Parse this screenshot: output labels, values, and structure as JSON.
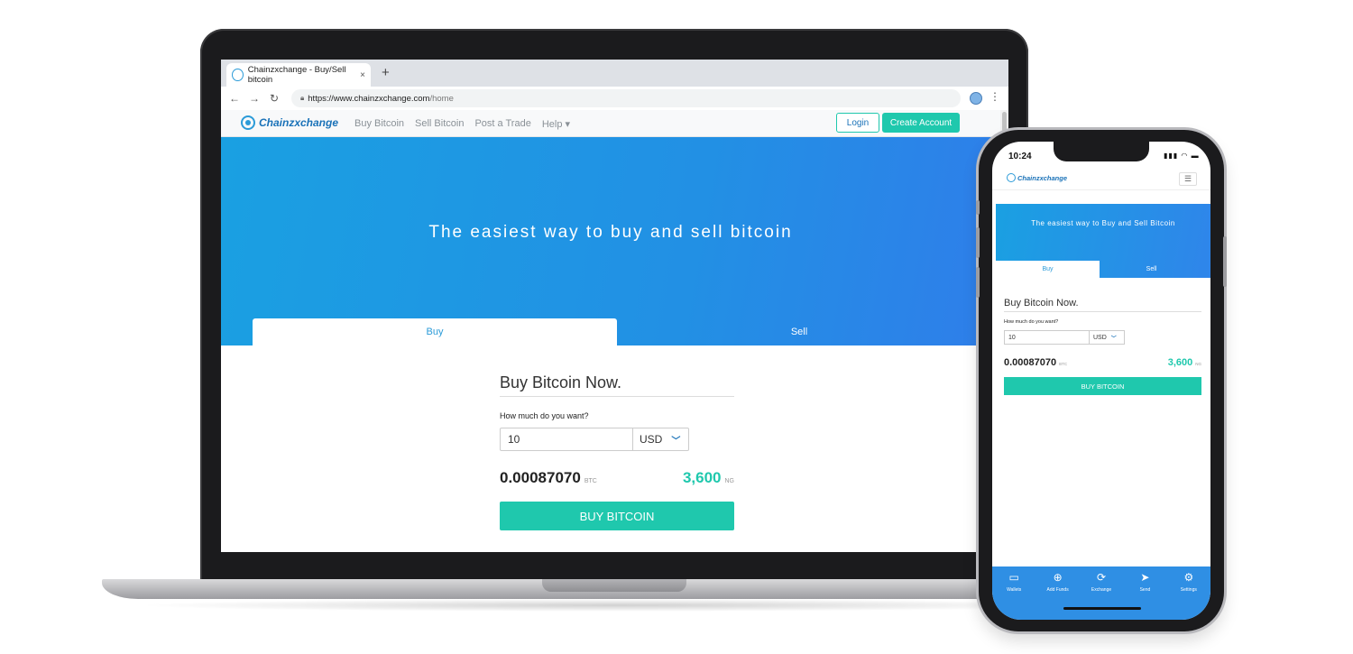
{
  "browser": {
    "tab_title": "Chainzxchange - Buy/Sell bitcoin",
    "tab_close": "×",
    "new_tab": "+",
    "url_host": "https://www.chainzxchange.com",
    "url_path": "/home",
    "back": "←",
    "forward": "→",
    "reload": "↻",
    "menu": "⋮"
  },
  "site": {
    "logo_text": "Chainzxchange",
    "nav": [
      "Buy Bitcoin",
      "Sell Bitcoin",
      "Post a Trade",
      "Help ▾"
    ],
    "login": "Login",
    "create_account": "Create Account",
    "hero_title": "The easiest way to buy and sell bitcoin",
    "tab_buy": "Buy",
    "tab_sell": "Sell",
    "form": {
      "heading": "Buy Bitcoin Now.",
      "amount_label": "How much do you want?",
      "amount_value": "10",
      "currency": "USD",
      "btc_amount": "0.00087070",
      "btc_unit": "BTC",
      "ngn_amount": "3,600",
      "ngn_unit": "NG",
      "buy_button": "BUY BITCOIN"
    }
  },
  "phone": {
    "time": "10:24",
    "status_icons": "▮▮▮ ◠ ▬",
    "logo_text": "Chainzxchange",
    "menu_icon": "☰",
    "hero_title": "The easiest way  to Buy and Sell Bitcoin",
    "tab_buy": "Buy",
    "tab_sell": "Sell",
    "form": {
      "heading": "Buy Bitcoin Now.",
      "amount_label": "How much do you want?",
      "amount_value": "10",
      "currency": "USD",
      "btc_amount": "0.00087070",
      "btc_unit": "BTC",
      "ngn_amount": "3,600",
      "ngn_unit": "NG",
      "buy_button": "BUY BITCOIN"
    },
    "tabbar": [
      {
        "label": "Wallets",
        "icon": "▭"
      },
      {
        "label": "Add Funds",
        "icon": "⊕"
      },
      {
        "label": "Exchange",
        "icon": "⟳"
      },
      {
        "label": "Send",
        "icon": "➤"
      },
      {
        "label": "Settings",
        "icon": "⚙"
      }
    ]
  },
  "colors": {
    "accent_teal": "#1fc8ad",
    "hero_blue": "#1aa0e2",
    "brand_blue": "#1a72b8"
  }
}
